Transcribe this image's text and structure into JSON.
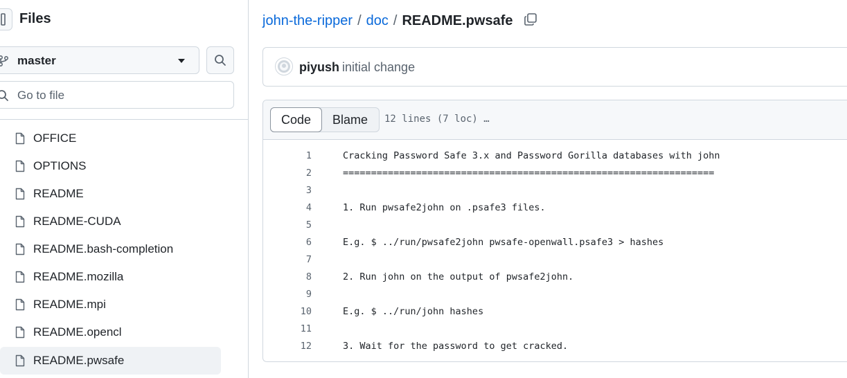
{
  "sidebar": {
    "title": "Files",
    "branch": "master",
    "goto_placeholder": "Go to file",
    "files": [
      {
        "name": "OFFICE",
        "selected": false
      },
      {
        "name": "OPTIONS",
        "selected": false
      },
      {
        "name": "README",
        "selected": false
      },
      {
        "name": "README-CUDA",
        "selected": false
      },
      {
        "name": "README.bash-completion",
        "selected": false
      },
      {
        "name": "README.mozilla",
        "selected": false
      },
      {
        "name": "README.mpi",
        "selected": false
      },
      {
        "name": "README.opencl",
        "selected": false
      },
      {
        "name": "README.pwsafe",
        "selected": true
      }
    ]
  },
  "breadcrumb": {
    "repo": "john-the-ripper",
    "sep1": "/",
    "folder": "doc",
    "sep2": "/",
    "file": "README.pwsafe"
  },
  "commit": {
    "author": "piyush",
    "message": "initial change"
  },
  "code_view": {
    "tabs": {
      "code": "Code",
      "blame": "Blame"
    },
    "active_tab": "Code",
    "info": "12 lines (7 loc) …",
    "lines": [
      {
        "n": "1",
        "text": "Cracking Password Safe 3.x and Password Gorilla databases with john"
      },
      {
        "n": "2",
        "text": "=================================================================="
      },
      {
        "n": "3",
        "text": ""
      },
      {
        "n": "4",
        "text": "1. Run pwsafe2john on .psafe3 files."
      },
      {
        "n": "5",
        "text": ""
      },
      {
        "n": "6",
        "text": "E.g. $ ../run/pwsafe2john pwsafe-openwall.psafe3 > hashes"
      },
      {
        "n": "7",
        "text": ""
      },
      {
        "n": "8",
        "text": "2. Run john on the output of pwsafe2john."
      },
      {
        "n": "9",
        "text": ""
      },
      {
        "n": "10",
        "text": "E.g. $ ../run/john hashes"
      },
      {
        "n": "11",
        "text": ""
      },
      {
        "n": "12",
        "text": "3. Wait for the password to get cracked."
      }
    ]
  },
  "colors": {
    "link": "#0969da",
    "text": "#1f2328",
    "muted": "#59636e",
    "border": "#d0d7de",
    "selected_bg": "#eff2f5"
  }
}
